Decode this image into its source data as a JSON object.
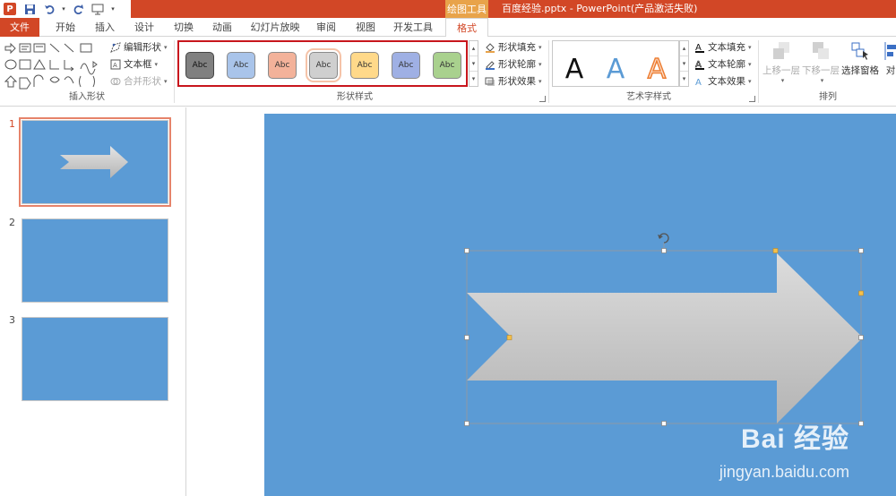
{
  "window": {
    "title": "百度经验.pptx -  PowerPoint(产品激活失败)",
    "context_tab_header": "绘图工具",
    "app_icon": "P"
  },
  "tabs": [
    {
      "label": "文件"
    },
    {
      "label": "开始"
    },
    {
      "label": "插入"
    },
    {
      "label": "设计"
    },
    {
      "label": "切换"
    },
    {
      "label": "动画"
    },
    {
      "label": "幻灯片放映"
    },
    {
      "label": "审阅"
    },
    {
      "label": "视图"
    },
    {
      "label": "开发工具"
    },
    {
      "label": "格式"
    }
  ],
  "ribbon": {
    "insert_shapes": {
      "label": "插入形状",
      "edit_shape": "编辑形状",
      "text_box": "文本框",
      "merge_shapes": "合并形状"
    },
    "shape_styles": {
      "label": "形状样式",
      "swatches": [
        {
          "text": "Abc",
          "color": "#808080"
        },
        {
          "text": "Abc",
          "color": "#a9c4ea"
        },
        {
          "text": "Abc",
          "color": "#f3b29a"
        },
        {
          "text": "Abc",
          "color": "#cfcfcf"
        },
        {
          "text": "Abc",
          "color": "#ffd98a"
        },
        {
          "text": "Abc",
          "color": "#9fb0e4"
        },
        {
          "text": "Abc",
          "color": "#a9d18e"
        }
      ],
      "shape_fill": "形状填充",
      "shape_outline": "形状轮廓",
      "shape_effects": "形状效果"
    },
    "wordart": {
      "label": "艺术字样式",
      "sample": "A",
      "text_fill": "文本填充",
      "text_outline": "文本轮廓",
      "text_effects": "文本效果"
    },
    "arrange": {
      "label": "排列",
      "bring_forward": "上移一层",
      "send_backward": "下移一层",
      "selection_pane": "选择窗格",
      "align_partial": "对"
    }
  },
  "slides": [
    {
      "number": "1"
    },
    {
      "number": "2"
    },
    {
      "number": "3"
    }
  ],
  "watermark": {
    "brand": "Bai 经验",
    "url": "jingyan.baidu.com"
  },
  "colors": {
    "accent": "#d24726",
    "slide_bg": "#5b9bd5",
    "arrow_fill": "#cfcfcf",
    "highlight_box": "#c8161d"
  }
}
